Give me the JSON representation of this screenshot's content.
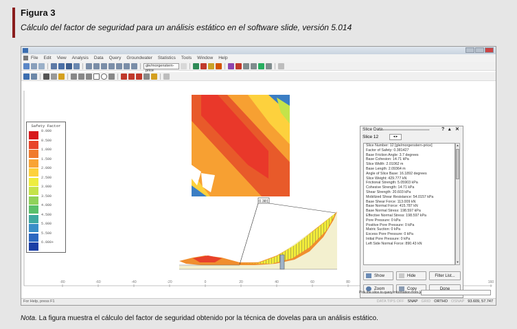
{
  "figure": {
    "label": "Figura 3",
    "caption": "Cálculo del factor de seguridad para un análisis estático en el software slide, versión 5.014",
    "note_label": "Nota.",
    "note_text": " La figura muestra el cálculo del factor de seguridad obtenido por la técnica de dovelas para un análisis estático."
  },
  "app": {
    "menu": [
      "File",
      "Edit",
      "View",
      "Analysis",
      "Data",
      "Query",
      "Groundwater",
      "Statistics",
      "Tools",
      "Window",
      "Help"
    ],
    "toolbar_combo": "gle/morgenstern-price"
  },
  "legend": {
    "title": "Safety Factor",
    "entries": [
      {
        "label": "0.000",
        "color": "#d7191c"
      },
      {
        "label": "0.500",
        "color": "#e8452a"
      },
      {
        "label": "1.000",
        "color": "#f07b2e"
      },
      {
        "label": "1.500",
        "color": "#f9a335"
      },
      {
        "label": "2.000",
        "color": "#fdd13d"
      },
      {
        "label": "2.500",
        "color": "#eeed3e"
      },
      {
        "label": "3.000",
        "color": "#c4e34a"
      },
      {
        "label": "3.500",
        "color": "#8fd25a"
      },
      {
        "label": "4.000",
        "color": "#5ac06a"
      },
      {
        "label": "4.500",
        "color": "#3fa9a0"
      },
      {
        "label": "5.000",
        "color": "#3a8ec8"
      },
      {
        "label": "5.500",
        "color": "#2c68c0"
      },
      {
        "label": "6.000+",
        "color": "#1b3fa6"
      }
    ]
  },
  "slice_panel": {
    "title": "Slice Data",
    "help_icon": "?",
    "slice_label": "Slice 12",
    "items": [
      "Slice Number: 12 [gle/morgenstern-price]",
      "Factor of Safety: 0.381427",
      "Base Friction Angle: 3.7 degrees",
      "Base Cohesion: 14.71 kPa",
      "Slice Width: 2.01062 m",
      "Base Length: 2.09364 m",
      "Angle of Slice Base: 16.1892 degrees",
      "Slice Weight: 429.777 kN",
      "Frictional Strength: 5.05903 kPa",
      "Cohesive Strength: 14.71 kPa",
      "Shear Strength: 20.603 kPa",
      "Mobilized Shear Resistance: 54.0157 kPa",
      "Base Shear Force: 113.009 kN",
      "Base Normal Force: 415.787 kN",
      "Base Normal Stress: 198.597 kPa",
      "Effective Normal Stress: 198.597 kPa",
      "Pore Pressure: 0 kPa",
      "Positive Pore Pressure: 0 kPa",
      "Matric Suction: 0 kPa",
      "Excess Pore Pressure: 0 kPa",
      "Initial Pore Pressure: 0 kPa",
      "Left Side Normal Force: 890.43 kN"
    ],
    "buttons": {
      "show": "Show",
      "hide": "Hide",
      "filter": "Filter List...",
      "zoom": "Zoom",
      "copy": "Copy",
      "done": "Done"
    }
  },
  "model": {
    "fs_label": "0.381",
    "axis_labels": [
      "-80",
      "-60",
      "-40",
      "-20",
      "0",
      "20",
      "40",
      "60",
      "80",
      "100",
      "120",
      "140",
      "160"
    ]
  },
  "status": {
    "help": "For Help, press F1",
    "pick": "Pick the slice to query information from [esc=quit]",
    "right": [
      "DATA TIPS OFF",
      "SNAP",
      "GRID",
      "ORTHO",
      "OSNAP",
      "93.609, 57.747"
    ]
  }
}
